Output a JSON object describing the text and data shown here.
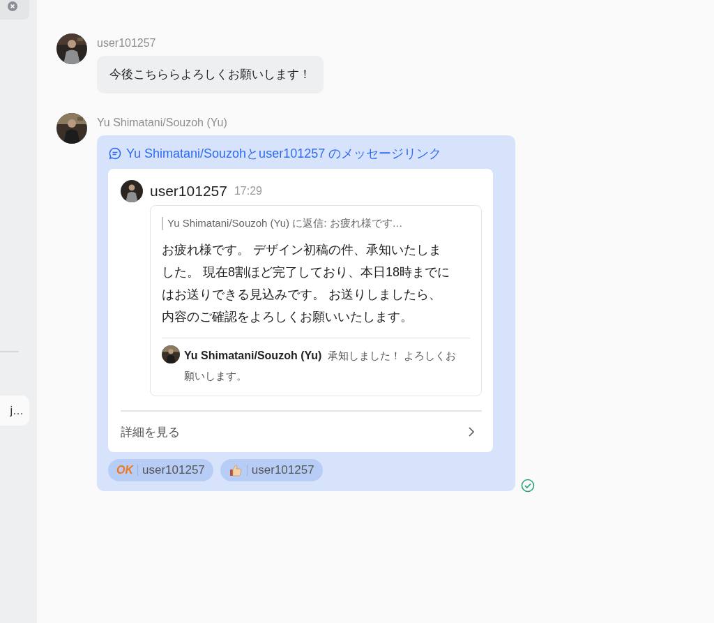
{
  "sidebar": {
    "cards": [
      {
        "text": "j…"
      }
    ]
  },
  "messages": [
    {
      "kind": "text",
      "author": "user101257",
      "text": "今後こちららよろしくお願いします！"
    },
    {
      "kind": "link",
      "author": "Yu Shimatani/Souzoh (Yu)",
      "link_title": "Yu Shimatani/Souzohとuser101257 のメッセージリンク",
      "quoted": {
        "author": "user101257",
        "time": "17:29",
        "reply_to": "Yu Shimatani/Souzoh (Yu) に返信:  お疲れ様です…",
        "body": "お疲れ様です。 デザイン初稿の件、承知いたしました。 現在8割ほど完了しており、本日18時までにはお送りできる見込みです。 お送りしましたら、内容のご確認をよろしくお願いいたします。",
        "reply": {
          "author": "Yu Shimatani/Souzoh (Yu)",
          "text": "承知しました！ よろしくお願いします。"
        }
      },
      "details": "詳細を見る",
      "reactions": [
        {
          "kind": "ok",
          "emoji": "OK",
          "user": "user101257"
        },
        {
          "kind": "thumb",
          "user": "user101257"
        }
      ],
      "read": true
    }
  ]
}
